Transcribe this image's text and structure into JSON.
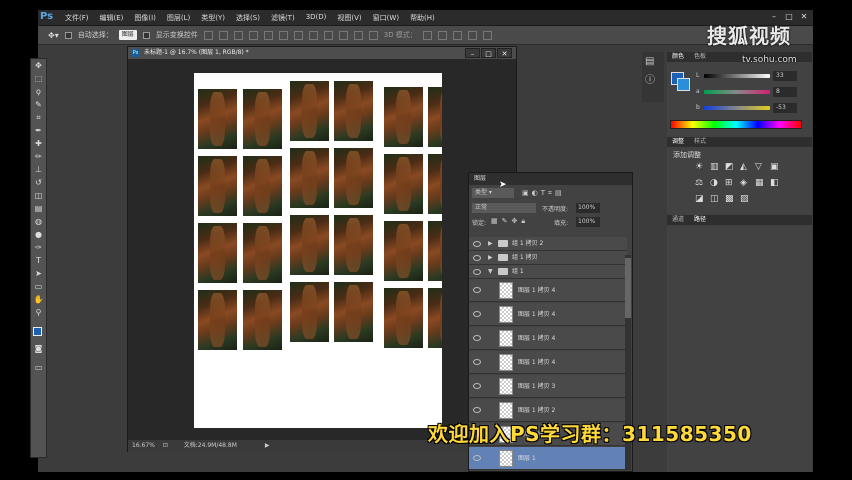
{
  "app": {
    "logo": "Ps",
    "menus": [
      "文件(F)",
      "编辑(E)",
      "图像(I)",
      "图层(L)",
      "类型(Y)",
      "选择(S)",
      "滤镜(T)",
      "3D(D)",
      "视图(V)",
      "窗口(W)",
      "帮助(H)"
    ],
    "window_controls": [
      "–",
      "□",
      "✕"
    ]
  },
  "options_bar": {
    "auto_select_label": "自动选择：",
    "auto_select_value": "图层",
    "show_transform_label": "显示变换控件",
    "mode_3d_label": "3D 模式："
  },
  "tools": [
    "move-icon",
    "marquee-icon",
    "lasso-icon",
    "quick-select-icon",
    "crop-icon",
    "eyedropper-icon",
    "healing-icon",
    "brush-icon",
    "stamp-icon",
    "history-brush-icon",
    "eraser-icon",
    "gradient-icon",
    "blur-icon",
    "dodge-icon",
    "pen-icon",
    "type-icon",
    "path-select-icon",
    "shape-icon",
    "hand-icon",
    "zoom-icon"
  ],
  "tool_glyphs": [
    "✥",
    "⬚",
    "ϙ",
    "✎",
    "⌗",
    "✒",
    "✚",
    "✏",
    "⊥",
    "↺",
    "◫",
    "▤",
    "◍",
    "●",
    "✑",
    "T",
    "➤",
    "▭",
    "✋",
    "⚲"
  ],
  "document": {
    "title": "未标题-1 @ 16.7% (图层 1, RGB/8) *",
    "zoom": "16.67%",
    "doc_size": "文档:24.9M/48.8M"
  },
  "color_panel": {
    "tabs": [
      "颜色",
      "色板"
    ],
    "L_value": "33",
    "a_value": "8",
    "b_value": "-53",
    "foreground_color": "#1c5fb5",
    "background_color": "#2a8fd8"
  },
  "adjust_panel": {
    "tabs": [
      "调整",
      "样式"
    ],
    "add_label": "添加调整"
  },
  "paths_panel": {
    "tabs": [
      "通道",
      "路径"
    ]
  },
  "layers_panel": {
    "tab": "图层",
    "filter_label": "类型",
    "blend_mode": "正常",
    "opacity_label": "不透明度:",
    "opacity_value": "100%",
    "lock_label": "锁定:",
    "fill_label": "填充:",
    "fill_value": "100%",
    "rows": [
      {
        "name": "组 1 拷贝 2",
        "type": "group",
        "expanded": false
      },
      {
        "name": "组 1 拷贝",
        "type": "group",
        "expanded": false
      },
      {
        "name": "组 1",
        "type": "group",
        "expanded": true
      },
      {
        "name": "图层 1 拷贝 4",
        "type": "layer"
      },
      {
        "name": "图层 1 拷贝 4",
        "type": "layer"
      },
      {
        "name": "图层 1 拷贝 4",
        "type": "layer"
      },
      {
        "name": "图层 1 拷贝 4",
        "type": "layer"
      },
      {
        "name": "图层 1 拷贝 3",
        "type": "layer"
      },
      {
        "name": "图层 1 拷贝 2",
        "type": "layer"
      },
      {
        "name": "图层 1 拷贝",
        "type": "layer"
      },
      {
        "name": "图层 1",
        "type": "layer",
        "selected": true
      }
    ]
  },
  "watermark": {
    "brand": "搜狐视频",
    "url": "tv.sohu.com"
  },
  "banner": "欢迎加入PS学习群：311585350"
}
